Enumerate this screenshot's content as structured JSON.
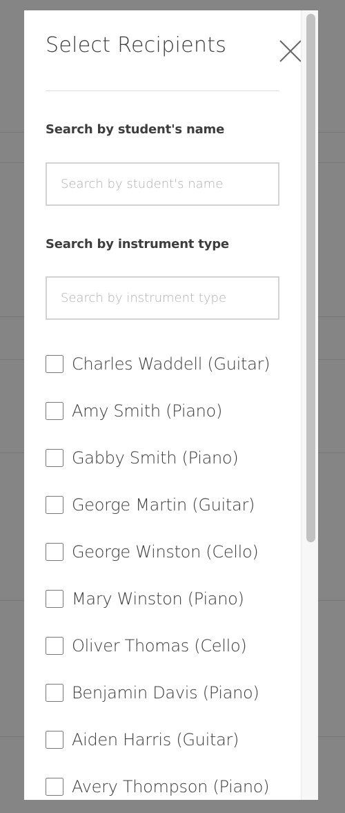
{
  "modal": {
    "title": "Select Recipients",
    "close_icon": "close-icon"
  },
  "filters": {
    "student_label": "Search by student's name",
    "student_placeholder": "Search by student's name",
    "student_value": "",
    "instrument_label": "Search by instrument type",
    "instrument_placeholder": "Search by instrument type",
    "instrument_value": ""
  },
  "recipients": [
    {
      "label": "Charles Waddell (Guitar)",
      "checked": false
    },
    {
      "label": "Amy Smith (Piano)",
      "checked": false
    },
    {
      "label": "Gabby Smith (Piano)",
      "checked": false
    },
    {
      "label": "George Martin (Guitar)",
      "checked": false
    },
    {
      "label": "George Winston (Cello)",
      "checked": false
    },
    {
      "label": "Mary Winston (Piano)",
      "checked": false
    },
    {
      "label": "Oliver Thomas (Cello)",
      "checked": false
    },
    {
      "label": "Benjamin Davis (Piano)",
      "checked": false
    },
    {
      "label": "Aiden Harris (Guitar)",
      "checked": false
    },
    {
      "label": "Avery Thompson (Piano)",
      "checked": false
    }
  ],
  "colors": {
    "overlay": "#858585",
    "text": "#3a3a3a",
    "border": "#d2d2d2",
    "placeholder": "#b0b0b0"
  }
}
